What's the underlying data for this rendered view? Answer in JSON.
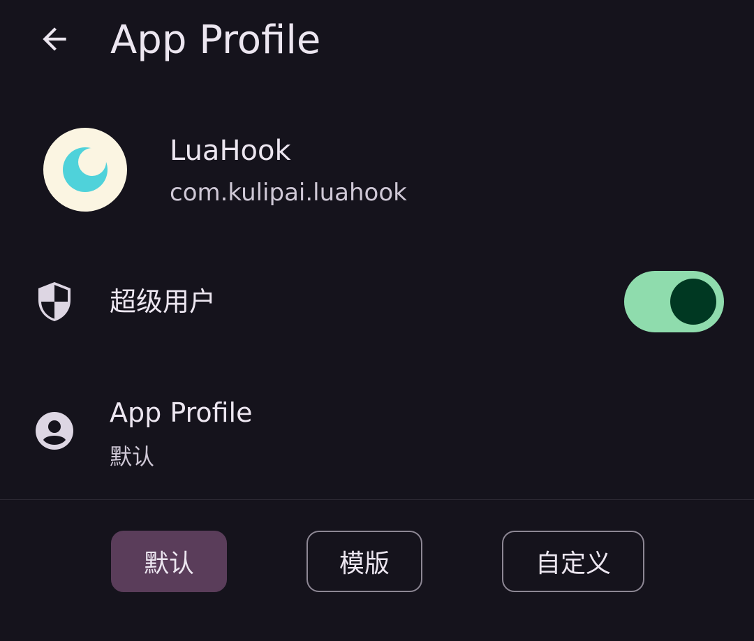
{
  "topbar": {
    "back_icon": "arrow-back-icon",
    "title": "App Profile"
  },
  "app": {
    "icon": "crescent-moon-icon",
    "name": "LuaHook",
    "package": "com.kulipai.luahook"
  },
  "superuser": {
    "icon": "shield-icon",
    "label": "超级用户",
    "enabled": true
  },
  "profile": {
    "icon": "account-circle-icon",
    "label": "App Profile",
    "value": "默认"
  },
  "profile_modes": {
    "options": [
      "默认",
      "模版",
      "自定义"
    ],
    "selected": "默认"
  },
  "colors": {
    "background": "#15131c",
    "toggle_track": "#8fdcad",
    "toggle_thumb": "#003822",
    "selected_button": "#5a3d5a",
    "app_icon_bg": "#fbf5e2",
    "app_icon_moon": "#4fd2da"
  }
}
